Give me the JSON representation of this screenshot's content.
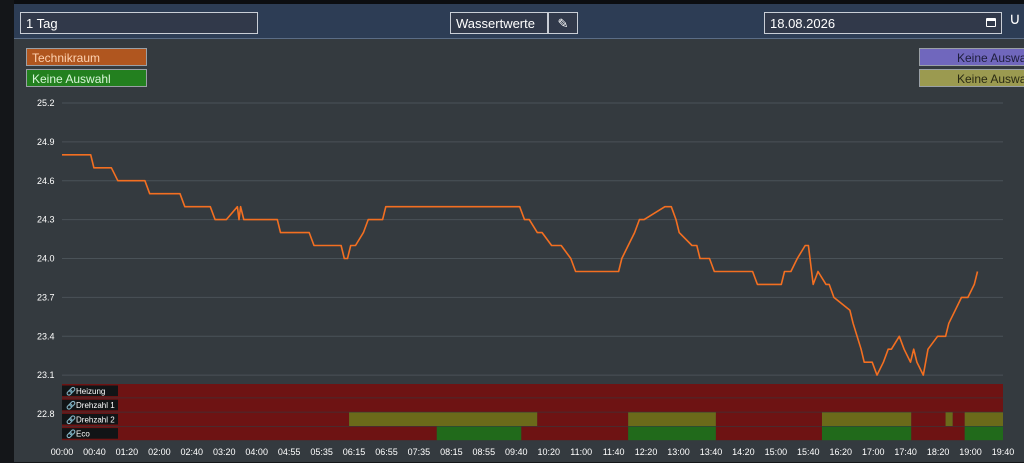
{
  "toolbar": {
    "range_value": "1 Tag",
    "mode_value": "Wassertwerte",
    "edit_glyph": "✎",
    "date_value": "18.08.2026",
    "calendar_icon": "calendar-icon",
    "edge_icon": "partial-logo-icon",
    "edge_glyph": "∪"
  },
  "legend": {
    "left": [
      {
        "label": "Technikraum",
        "color": "#b0561f"
      },
      {
        "label": "Keine Auswahl",
        "color": "#23801f"
      }
    ],
    "right": [
      {
        "label": "Keine Auswahl",
        "color": "#7067bd"
      },
      {
        "label": "Keine Auswahl",
        "color": "#9b9a50"
      }
    ]
  },
  "chart_data": {
    "type": "line",
    "title": "",
    "xlabel": "",
    "ylabel": "",
    "ylim": [
      22.8,
      25.2
    ],
    "y_ticks": [
      "25.2",
      "24.9",
      "24.6",
      "24.3",
      "24.0",
      "23.7",
      "23.4",
      "23.1",
      "22.8"
    ],
    "x_ticks": [
      "00:00",
      "00:40",
      "01:20",
      "02:00",
      "02:40",
      "03:20",
      "04:00",
      "04:55",
      "05:35",
      "06:15",
      "06:55",
      "07:35",
      "08:15",
      "08:55",
      "09:40",
      "10:20",
      "11:00",
      "11:40",
      "12:20",
      "13:00",
      "13:40",
      "14:20",
      "15:00",
      "15:40",
      "16:20",
      "17:00",
      "17:40",
      "18:20",
      "19:00",
      "19:40"
    ],
    "series": [
      {
        "name": "Technikraum",
        "color": "#f36f21",
        "x_minutes": [
          0,
          36,
          40,
          62,
          70,
          104,
          110,
          148,
          154,
          186,
          192,
          206,
          220,
          222,
          224,
          228,
          270,
          274,
          310,
          316,
          350,
          354,
          358,
          362,
          368,
          378,
          384,
          402,
          406,
          438,
          574,
          580,
          586,
          596,
          602,
          614,
          626,
          638,
          644,
          698,
          702,
          710,
          718,
          724,
          730,
          756,
          764,
          770,
          774,
          790,
          796,
          800,
          812,
          818,
          828,
          852,
          866,
          872,
          876,
          902,
          906,
          914,
          922,
          932,
          936,
          938,
          940,
          942,
          948,
          958,
          962,
          968,
          988,
          992,
          1002,
          1006,
          1016,
          1022,
          1030,
          1036,
          1040,
          1050,
          1056,
          1064,
          1068,
          1072,
          1080,
          1086,
          1098,
          1108,
          1112,
          1120,
          1128,
          1136,
          1144,
          1148,
          1156,
          1160,
          1166,
          1176,
          1180
        ],
        "y_values": [
          24.8,
          24.8,
          24.7,
          24.7,
          24.6,
          24.6,
          24.5,
          24.5,
          24.4,
          24.4,
          24.3,
          24.3,
          24.4,
          24.3,
          24.4,
          24.3,
          24.3,
          24.2,
          24.2,
          24.1,
          24.1,
          24.0,
          24.0,
          24.1,
          24.1,
          24.2,
          24.3,
          24.3,
          24.4,
          24.4,
          24.4,
          24.3,
          24.3,
          24.2,
          24.2,
          24.1,
          24.1,
          24.0,
          23.9,
          23.9,
          24.0,
          24.1,
          24.2,
          24.3,
          24.3,
          24.4,
          24.4,
          24.3,
          24.2,
          24.1,
          24.1,
          24.0,
          24.0,
          23.9,
          23.9,
          23.9,
          23.9,
          23.8,
          23.8,
          23.8,
          23.9,
          23.9,
          24.0,
          24.1,
          24.1,
          24.0,
          23.9,
          23.8,
          23.9,
          23.8,
          23.8,
          23.7,
          23.6,
          23.5,
          23.3,
          23.2,
          23.2,
          23.1,
          23.2,
          23.3,
          23.3,
          23.4,
          23.3,
          23.2,
          23.3,
          23.2,
          23.1,
          23.3,
          23.4,
          23.4,
          23.5,
          23.6,
          23.7,
          23.7,
          23.8,
          23.9
        ]
      }
    ],
    "status_rows": [
      {
        "label": "Heizung",
        "icon": "link-icon",
        "segments": [
          {
            "from": 0,
            "to": 1180,
            "state": "off"
          }
        ]
      },
      {
        "label": "Drehzahl 1",
        "icon": "link-icon",
        "segments": [
          {
            "from": 0,
            "to": 1180,
            "state": "off"
          }
        ]
      },
      {
        "label": "Drehzahl 2",
        "icon": "link-icon",
        "segments": [
          {
            "from": 0,
            "to": 360,
            "state": "off"
          },
          {
            "from": 360,
            "to": 596,
            "state": "partial"
          },
          {
            "from": 596,
            "to": 710,
            "state": "off"
          },
          {
            "from": 710,
            "to": 820,
            "state": "partial"
          },
          {
            "from": 820,
            "to": 953,
            "state": "off"
          },
          {
            "from": 953,
            "to": 1065,
            "state": "partial"
          },
          {
            "from": 1065,
            "to": 1108,
            "state": "off"
          },
          {
            "from": 1108,
            "to": 1117,
            "state": "partial"
          },
          {
            "from": 1117,
            "to": 1132,
            "state": "off"
          },
          {
            "from": 1132,
            "to": 1180,
            "state": "partial"
          }
        ]
      },
      {
        "label": "Eco",
        "icon": "link-icon",
        "segments": [
          {
            "from": 0,
            "to": 470,
            "state": "off"
          },
          {
            "from": 470,
            "to": 576,
            "state": "on"
          },
          {
            "from": 576,
            "to": 710,
            "state": "off"
          },
          {
            "from": 710,
            "to": 820,
            "state": "on"
          },
          {
            "from": 820,
            "to": 953,
            "state": "off"
          },
          {
            "from": 953,
            "to": 1065,
            "state": "on"
          },
          {
            "from": 1065,
            "to": 1132,
            "state": "off"
          },
          {
            "from": 1132,
            "to": 1180,
            "state": "on"
          }
        ]
      }
    ],
    "state_colors": {
      "off": "#6e1313",
      "on": "#216a1b",
      "partial": "#6b6a1a"
    },
    "x_range_minutes": [
      0,
      1180
    ],
    "grid": true
  }
}
